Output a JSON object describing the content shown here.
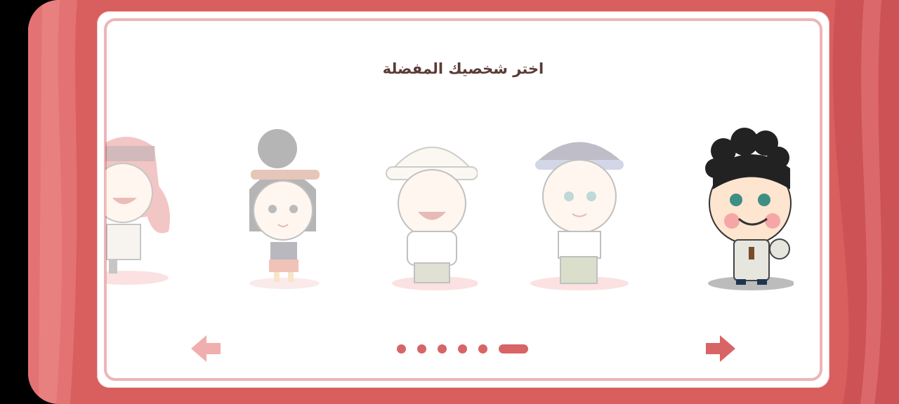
{
  "screen": {
    "title": "اختر شخصيك المفضلة",
    "accent_color": "#d86466",
    "background_color": "#d95f5f"
  },
  "characters": [
    {
      "name": "boy-curly-hair",
      "selected": true
    },
    {
      "name": "boy-patterned-cap",
      "selected": false
    },
    {
      "name": "boy-white-kufi",
      "selected": false
    },
    {
      "name": "girl-hair-bun",
      "selected": false
    },
    {
      "name": "girl-red-hair",
      "selected": false
    }
  ],
  "pagination": {
    "count": 6,
    "active_index": 5
  },
  "nav": {
    "prev_icon": "arrow-left-icon",
    "next_icon": "arrow-right-icon"
  }
}
